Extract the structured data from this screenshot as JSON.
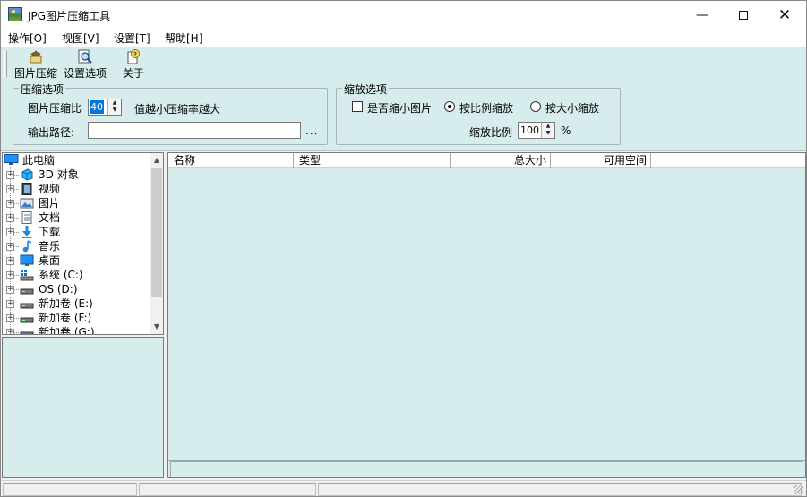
{
  "window": {
    "title": "JPG图片压缩工具"
  },
  "menu": {
    "items": [
      "操作[O]",
      "视图[V]",
      "设置[T]",
      "帮助[H]"
    ]
  },
  "toolbar": {
    "buttons": [
      "图片压缩",
      "设置选项",
      "关于"
    ]
  },
  "compress_group": {
    "title": "压缩选项",
    "ratio_label": "图片压缩比",
    "ratio_value": "40",
    "ratio_hint": "值越小压缩率越大",
    "output_label": "输出路径:",
    "output_value": "",
    "browse_label": "..."
  },
  "scale_group": {
    "title": "缩放选项",
    "shrink_label": "是否缩小图片",
    "shrink_checked": false,
    "proportional_label": "按比例缩放",
    "by_size_label": "按大小缩放",
    "selected_mode": "proportional",
    "scale_label": "缩放比例",
    "scale_value": "100",
    "scale_unit": "%"
  },
  "tree": {
    "root": "此电脑",
    "items": [
      {
        "label": "3D 对象",
        "icon": "3d-objects-icon"
      },
      {
        "label": "视频",
        "icon": "video-icon"
      },
      {
        "label": "图片",
        "icon": "pictures-icon"
      },
      {
        "label": "文档",
        "icon": "documents-icon"
      },
      {
        "label": "下载",
        "icon": "download-icon"
      },
      {
        "label": "音乐",
        "icon": "music-icon"
      },
      {
        "label": "桌面",
        "icon": "desktop-icon"
      },
      {
        "label": "系统 (C:)",
        "icon": "system-drive-icon"
      },
      {
        "label": "OS (D:)",
        "icon": "drive-icon"
      },
      {
        "label": "新加卷 (E:)",
        "icon": "drive-icon"
      },
      {
        "label": "新加卷 (F:)",
        "icon": "drive-icon"
      },
      {
        "label": "新加卷 (G:)",
        "icon": "drive-icon"
      }
    ]
  },
  "list": {
    "columns": [
      "名称",
      "类型",
      "总大小",
      "可用空间"
    ]
  },
  "colors": {
    "panel_bg": "#d7ecec",
    "selection": "#0078d7"
  }
}
